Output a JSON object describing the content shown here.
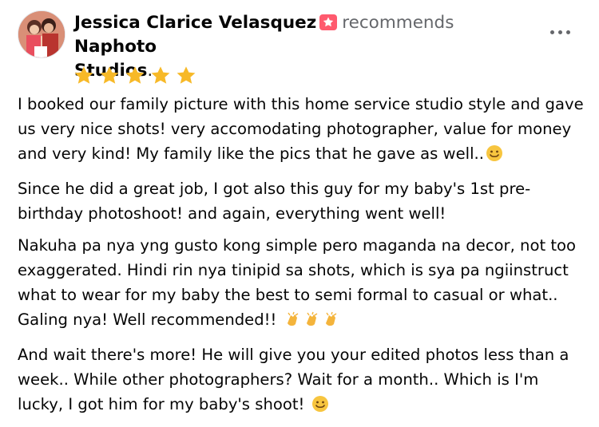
{
  "post": {
    "author": "Jessica Clarice Velasquez",
    "verb": "recommends",
    "target_line1": "Naphoto",
    "target_line2": "Studios",
    "rating": 5,
    "paragraphs": [
      "I booked our family picture with this home service studio style and gave us very nice shots! very accomodating photographer, value for money and very kind! My family like the pics that he gave as well..",
      "Since he did a great job, I got also this guy for my baby's 1st pre-birthday photoshoot! and again, everything went well!",
      "Nakuha pa nya yng gusto kong simple pero maganda na decor, not too exaggerated. Hindi rin nya tinipid sa shots, which is sya pa ngiinstruct what to wear for my baby the best to semi formal to casual or what.. Galing nya! Well recommended!! ",
      "And wait there's more! He will give you your edited photos less than a week.. While other photographers? Wait for a month.. Which is I'm lucky, I got him for my baby's shoot! "
    ]
  },
  "icons": {
    "badge": "top-fan-badge-icon",
    "more": "more-options-icon",
    "star": "star-icon",
    "smile": "smiling-face-emoji",
    "clap": "clapping-hands-emoji"
  },
  "colors": {
    "star": "#f7b928",
    "badge": "#ff5a6e",
    "secondary_text": "#65676b"
  }
}
